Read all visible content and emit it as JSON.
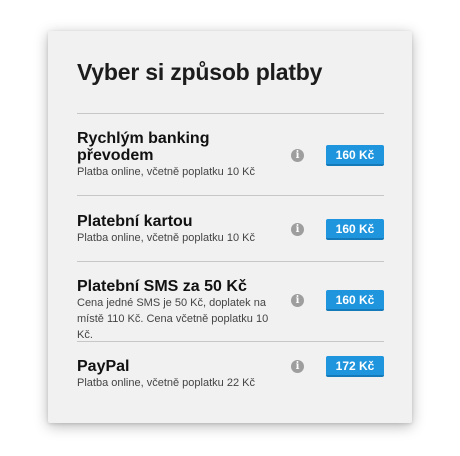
{
  "title": "Vyber si způsob platby",
  "options": [
    {
      "name": "Rychlým banking převodem",
      "description": "Platba online, včetně poplatku 10 Kč",
      "price": "160 Kč"
    },
    {
      "name": "Platební kartou",
      "description": "Platba online, včetně poplatku 10 Kč",
      "price": "160 Kč"
    },
    {
      "name": "Platební SMS za 50 Kč",
      "description": "Cena jedné SMS je 50 Kč, doplatek na místě 110 Kč. Cena včetně poplatku 10 Kč.",
      "price": "160 Kč"
    },
    {
      "name": "PayPal",
      "description": "Platba online, včetně poplatku 22 Kč",
      "price": "172 Kč"
    }
  ],
  "info_icon": "info-icon",
  "colors": {
    "button": "#1f95de",
    "panel": "#f1f1f1",
    "icon": "#9e9e9e"
  }
}
